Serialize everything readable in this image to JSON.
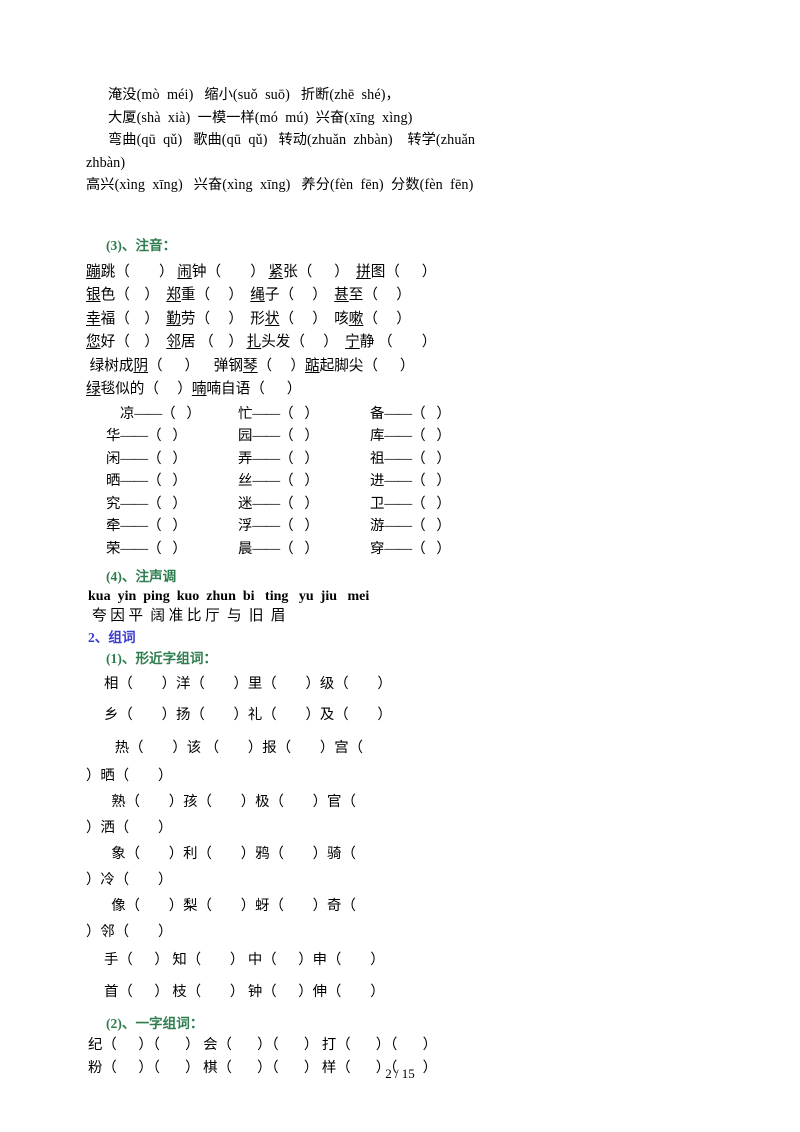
{
  "document": {
    "page_label": "2 / 15",
    "heading_color_green": "#2e7d4f",
    "heading_color_blue": "#3b3bd0"
  },
  "polyphone_block": {
    "line1": "淹没(mò  méi)   缩小(suǒ  suō)   折断(zhē  shé)，",
    "line2": "大厦(shà  xià)  一模一样(mó  mú)  兴奋(xīng  xìng)",
    "line3": "弯曲(qū  qǔ)   歌曲(qū  qǔ)   转动(zhuǎn  zhbàn)    转学(zhuǎn",
    "line4": "zhbàn)",
    "line5": "高兴(xìng  xīng)   兴奋(xìng  xīng)   养分(fèn  fēn)  分数(fèn  fēn)"
  },
  "section_zhuyin": {
    "heading": "(3)、注音：",
    "rows": [
      [
        {
          "pre": "",
          "u": "蹦",
          "post": "跳（        ）"
        },
        {
          "pre": "",
          "u": "闹",
          "post": "钟（        ）"
        },
        {
          "pre": "",
          "u": "紧",
          "post": "张（      ）"
        },
        {
          "pre": "",
          "u": "拼",
          "post": "图（      ）"
        }
      ],
      [
        {
          "pre": "",
          "u": "银",
          "post": "色（    ）"
        },
        {
          "pre": "",
          "u": "郑",
          "post": "重（     ）"
        },
        {
          "pre": "",
          "u": "绳",
          "post": "子（     ）"
        },
        {
          "pre": "",
          "u": "甚",
          "post": "至（     ）"
        }
      ],
      [
        {
          "pre": "",
          "u": "幸",
          "post": "福（    ）"
        },
        {
          "pre": "",
          "u": "勤",
          "post": "劳（     ）"
        },
        {
          "pre": "形",
          "u": "状",
          "post": "（     ）"
        },
        {
          "pre": "咳",
          "u": "嗽",
          "post": "（     ）"
        }
      ],
      [
        {
          "pre": "",
          "u": "您",
          "post": "好（    ）"
        },
        {
          "pre": "",
          "u": "邻",
          "post": "居 （    ）"
        },
        {
          "pre": "",
          "u": "扎",
          "post": "头发（     ）"
        },
        {
          "pre": "",
          "u": "宁",
          "post": "静 （        ）"
        }
      ]
    ],
    "row5": {
      "a_pre": " 绿树成",
      "a_u": "阴",
      "a_post": "（      ）",
      "b_pre": "    弹钢",
      "b_u": "琴",
      "b_post": "（     ）",
      "c_u": "踮",
      "c_post": "起脚尖（      ）"
    },
    "row6": {
      "a_u": "绿",
      "a_post": "毯似的（     ）",
      "b_u": "喃",
      "b_post": "喃自语（      ）"
    }
  },
  "dash_grid": {
    "rows": [
      [
        {
          "char": "凉",
          "blank": "（   ）"
        },
        {
          "char": "忙",
          "blank": "（   ）"
        },
        {
          "char": "备",
          "blank": "（   ）"
        }
      ],
      [
        {
          "char": "华",
          "blank": "（   ）"
        },
        {
          "char": "园",
          "blank": "（   ）"
        },
        {
          "char": "库",
          "blank": "（   ）"
        }
      ],
      [
        {
          "char": "闲",
          "blank": "（   ）"
        },
        {
          "char": "弄",
          "blank": "（   ）"
        },
        {
          "char": "祖",
          "blank": "（   ）"
        }
      ],
      [
        {
          "char": "晒",
          "blank": "（   ）"
        },
        {
          "char": "丝",
          "blank": "（   ）"
        },
        {
          "char": "进",
          "blank": "（   ）"
        }
      ],
      [
        {
          "char": "究",
          "blank": "（   ）"
        },
        {
          "char": "迷",
          "blank": "（   ）"
        },
        {
          "char": "卫",
          "blank": "（   ）"
        }
      ],
      [
        {
          "char": "牵",
          "blank": "（   ）"
        },
        {
          "char": "浮",
          "blank": "（   ）"
        },
        {
          "char": "游",
          "blank": "（   ）"
        }
      ],
      [
        {
          "char": "荣",
          "blank": "（   ）"
        },
        {
          "char": "晨",
          "blank": "（   ）"
        },
        {
          "char": "穿",
          "blank": "（   ）"
        }
      ]
    ],
    "dash": "——"
  },
  "section_tone": {
    "heading": "(4)、注声调",
    "pinyin_line": "kua  yin  ping  kuo  zhun  bi   ting   yu  jiu   mei",
    "hanzi_line": "夸 因 平  阔 准 比 厅  与  旧  眉"
  },
  "section_zuci": {
    "heading": "2、组词",
    "sub1_heading": "(1)、形近字组词：",
    "rows_simple": [
      "相（        ）洋（        ）里（        ）级（        ）",
      "乡（        ）扬（        ）礼（        ）及（        ）"
    ],
    "rows_wrapped": [
      {
        "a": "   热（        ）该 （        ）报（        ）宫（",
        "b": "）晒（        ）"
      },
      {
        "a": "  熟（        ）孩（        ）极（        ）官（",
        "b": "）洒（        ）"
      },
      {
        "a": "  象（        ）利（        ）鸦（        ）骑（",
        "b": "）冷（        ）"
      },
      {
        "a": "  像（        ）梨（        ）蚜（        ）奇（",
        "b": "）邻（        ）"
      }
    ],
    "rows_simple2": [
      "手（      ） 知（        ） 中（      ）申（        ）",
      "首（      ） 枝（        ） 钟（      ）伸（        ）"
    ],
    "sub2_heading": "(2)、一字组词：",
    "rows_yizi": [
      "纪（      ）（       ） 会（       ）（       ） 打（       ）（       ）",
      "粉（      ）（       ） 棋（       ）（       ） 样（       ）（       ）"
    ]
  }
}
